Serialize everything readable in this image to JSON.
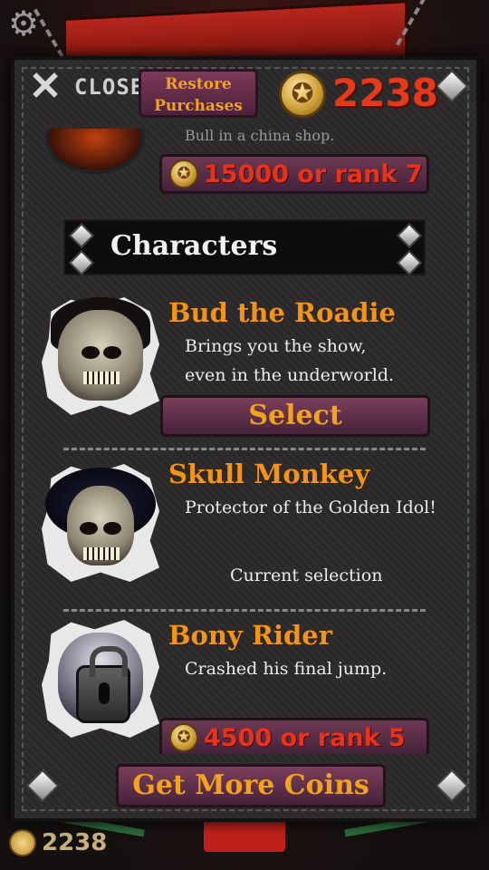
{
  "header": {
    "close_label": "CLOSE",
    "restore_line1": "Restore",
    "restore_line2": "Purchases",
    "coin_count": "2238"
  },
  "previous_item": {
    "partial_text": "Bull in a china shop.",
    "price_label": "15000 or rank 7"
  },
  "section": {
    "title": "Characters"
  },
  "characters": [
    {
      "name": "Bud the Roadie",
      "description": "Brings you the show,\neven in the underworld.",
      "action_label": "Select"
    },
    {
      "name": "Skull Monkey",
      "description": "Protector of the Golden Idol!",
      "status_label": "Current selection"
    },
    {
      "name": "Bony Rider",
      "description": "Crashed his final jump.",
      "price_label": "4500 or rank 5"
    }
  ],
  "footer": {
    "get_coins_label": "Get More Coins"
  },
  "background": {
    "coin_count": "2238"
  },
  "colors": {
    "accent_orange": "#f0951a",
    "price_red": "#e8321a",
    "button_purple": "#7a3f5a"
  },
  "icons": {
    "settings": "gear-icon",
    "close": "crossed-axes-icon",
    "coin": "pentagram-coin-icon",
    "corner": "diamond-stud-icon",
    "lock": "padlock-icon"
  }
}
